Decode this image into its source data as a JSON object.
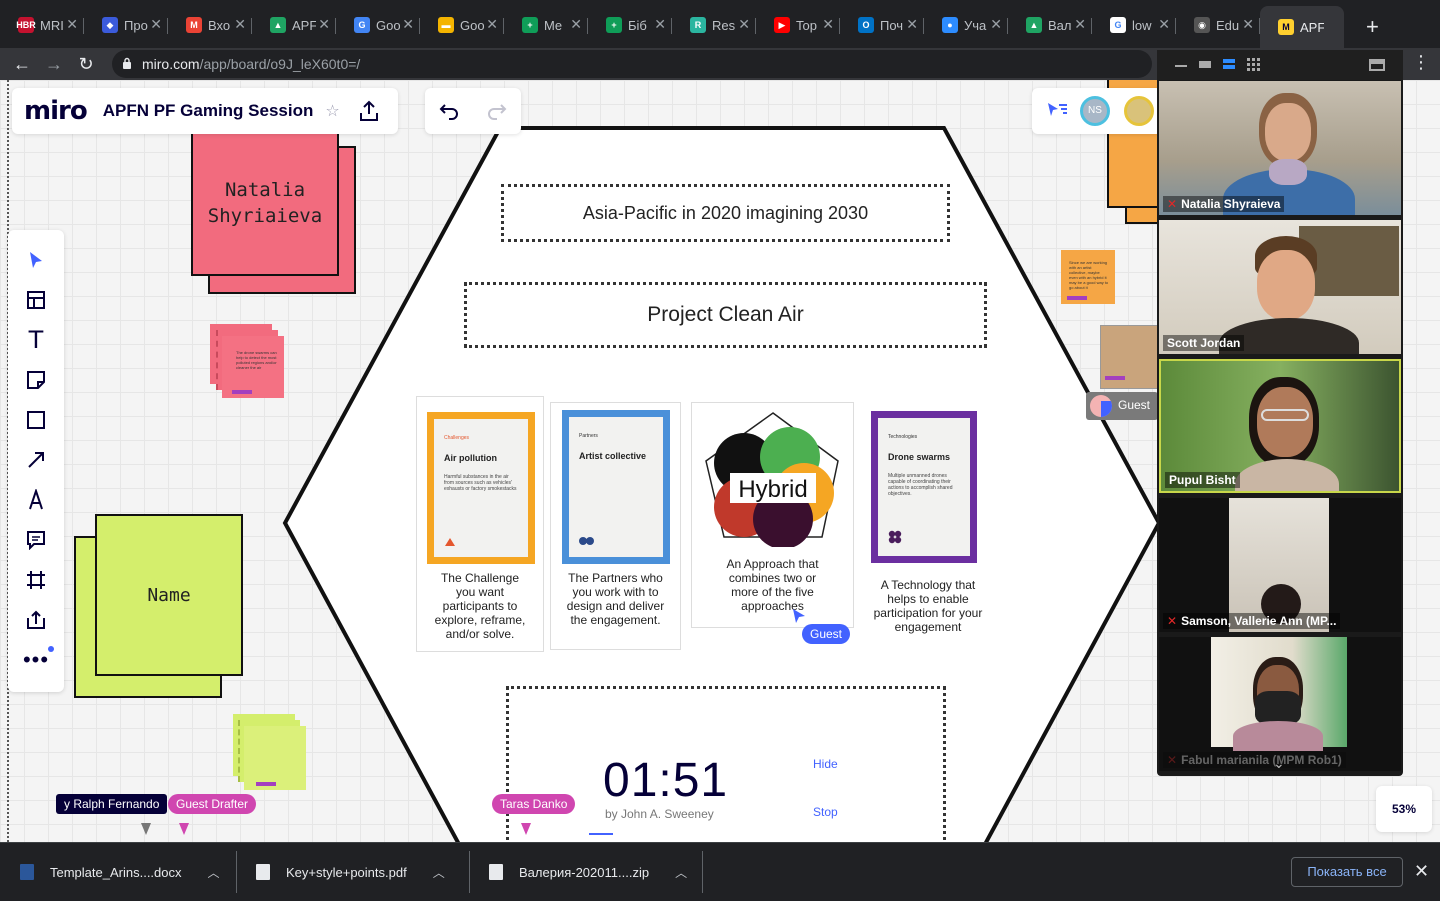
{
  "browser": {
    "tabs": [
      {
        "label": "MRI",
        "fav": "HBR",
        "color": "#c4122f"
      },
      {
        "label": "Про",
        "fav": "◆",
        "color": "#3b5bdb"
      },
      {
        "label": "Вхо",
        "fav": "M",
        "color": "#ea4335"
      },
      {
        "label": "APF",
        "fav": "▲",
        "color": "#1fa463"
      },
      {
        "label": "Goo",
        "fav": "G",
        "color": "#4285f4"
      },
      {
        "label": "Goo",
        "fav": "▬",
        "color": "#f4b400"
      },
      {
        "label": "Me",
        "fav": "+",
        "color": "#0f9d58"
      },
      {
        "label": "Біб",
        "fav": "+",
        "color": "#0f9d58"
      },
      {
        "label": "Res",
        "fav": "R",
        "color": "#2bb5a0"
      },
      {
        "label": "Top",
        "fav": "▶",
        "color": "#ff0000"
      },
      {
        "label": "Поч",
        "fav": "O",
        "color": "#0072c6"
      },
      {
        "label": "Уча",
        "fav": "●",
        "color": "#2d8cff"
      },
      {
        "label": "Вал",
        "fav": "▲",
        "color": "#1fa463"
      },
      {
        "label": "low",
        "fav": "G",
        "color": "#ffffff"
      },
      {
        "label": "Edu",
        "fav": "◉",
        "color": "#555555"
      },
      {
        "label": "APF",
        "fav": "M",
        "color": "#ffd02f"
      }
    ],
    "url_host": "miro.com",
    "url_path": "/app/board/o9J_leX60t0=/"
  },
  "miro": {
    "logo": "miro",
    "board_title": "APFN PF Gaming Session",
    "avatar_initials": "NS",
    "zoom": "53%"
  },
  "board": {
    "sticky_natalia": "Natalia\nShyriaieva",
    "sticky_name": "Name",
    "mini_sticky_pink": "The drone swarms can help to detect the most polluted regions and/or cleaner the air",
    "mini_sticky_orange": "Since we are working with an artist collective, maybe even with an hybrid it may be a good way to go about it",
    "frame_asia": "Asia-Pacific in 2020 imagining 2030",
    "frame_project": "Project Clean Air",
    "cards": [
      {
        "kicker": "Challenges",
        "title": "Air pollution",
        "body": "Harmful substances in the air from sources such as vehicles' exhausts or factory smokestacks",
        "desc": "The Challenge you want participants to explore, reframe, and/or solve.",
        "color": "#f5a623"
      },
      {
        "kicker": "Partners",
        "title": "Artist collective",
        "body": "",
        "desc": "The Partners who you work with to design and deliver the engagement.",
        "color": "#4a90d9"
      },
      {
        "title": "Hybrid",
        "desc": "An Approach that combines two or more of the five approaches"
      },
      {
        "kicker": "Technologies",
        "title": "Drone swarms",
        "body": "Multiple unmanned drones capable of coordinating their actions to accomplish shared objectives.",
        "desc": "A Technology that helps to enable participation for your engagement",
        "color": "#6b2fa0"
      }
    ],
    "timer": "01:51",
    "timer_by": "by John A. Sweeney",
    "timer_hide": "Hide",
    "timer_stop": "Stop",
    "cursors": {
      "guest_card": "Guest",
      "guest_right": "Guest",
      "ralph": "y Ralph Fernando",
      "guest_drafter": "Guest Drafter",
      "taras": "Taras Danko"
    }
  },
  "video": {
    "participants": [
      {
        "name": "Natalia Shyraieva",
        "muted": true
      },
      {
        "name": "Scott Jordan",
        "muted": false
      },
      {
        "name": "Pupul Bisht",
        "muted": false
      },
      {
        "name": "Samson, Vallerie Ann (MP...",
        "muted": true
      },
      {
        "name": "Fabul marianila (MPM Rob1)",
        "muted": true
      }
    ]
  },
  "downloads": {
    "items": [
      "Template_Arins....docx",
      "Key+style+points.pdf",
      "Валерия-202011....zip"
    ],
    "show_all": "Показать все"
  }
}
